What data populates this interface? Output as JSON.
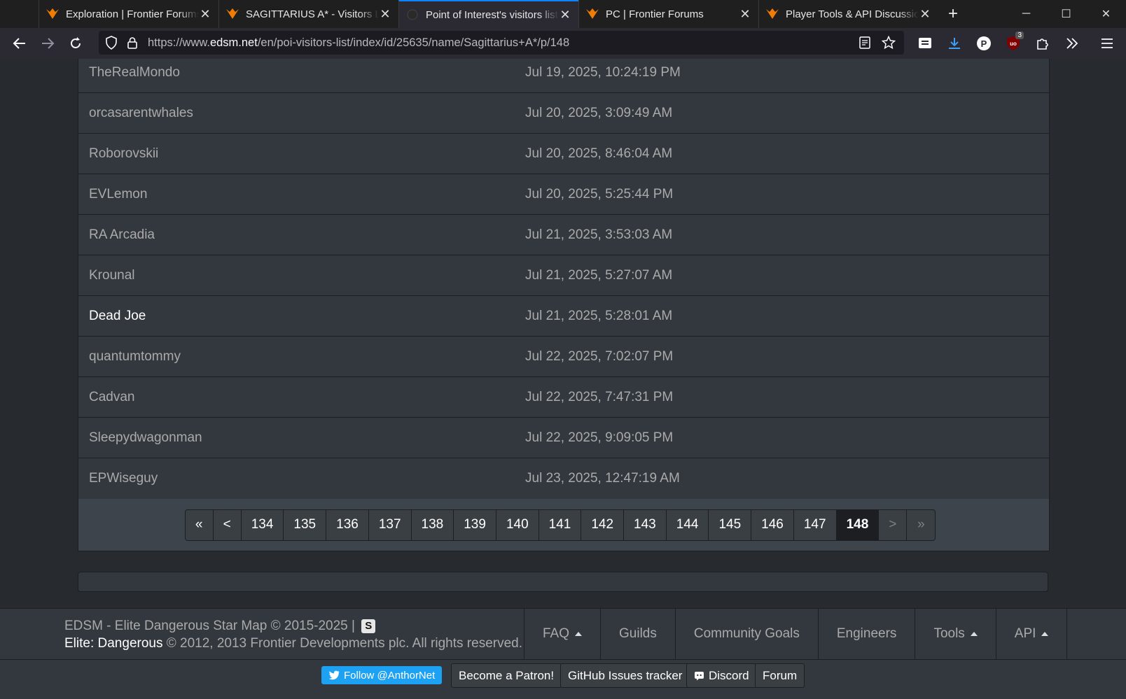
{
  "browser": {
    "tabs": [
      {
        "title": "Exploration | Frontier Forums",
        "active": false,
        "icon": "elite-icon"
      },
      {
        "title": "SAGITTARIUS A* - Visitors List",
        "active": false,
        "icon": "elite-icon"
      },
      {
        "title": "Point of Interest's visitors list",
        "active": true,
        "icon": "edsm-icon"
      },
      {
        "title": "PC | Frontier Forums",
        "active": false,
        "icon": "elite-icon"
      },
      {
        "title": "Player Tools & API Discussions",
        "active": false,
        "icon": "elite-icon"
      }
    ],
    "url_prefix": "https://www.",
    "url_host": "edsm.net",
    "url_path": "/en/poi-visitors-list/index/id/25635/name/Sagittarius+A*/p/148",
    "extension_badge": "3"
  },
  "visitors": [
    {
      "name": "TheRealMondo",
      "date": "Jul 19, 2025, 10:24:19 PM"
    },
    {
      "name": "orcasarentwhales",
      "date": "Jul 20, 2025, 3:09:49 AM"
    },
    {
      "name": "Roborovskii",
      "date": "Jul 20, 2025, 8:46:04 AM"
    },
    {
      "name": "EVLemon",
      "date": "Jul 20, 2025, 5:25:44 PM"
    },
    {
      "name": "RA Arcadia",
      "date": "Jul 21, 2025, 3:53:03 AM"
    },
    {
      "name": "Krounal",
      "date": "Jul 21, 2025, 5:27:07 AM"
    },
    {
      "name": "Dead Joe",
      "date": "Jul 21, 2025, 5:28:01 AM"
    },
    {
      "name": "quantumtommy",
      "date": "Jul 22, 2025, 7:02:07 PM"
    },
    {
      "name": "Cadvan",
      "date": "Jul 22, 2025, 7:47:31 PM"
    },
    {
      "name": "Sleepydwagonman",
      "date": "Jul 22, 2025, 9:09:05 PM"
    },
    {
      "name": "EPWiseguy",
      "date": "Jul 23, 2025, 12:47:19 AM"
    }
  ],
  "pagination": {
    "first": "«",
    "prev": "<",
    "pages": [
      "134",
      "135",
      "136",
      "137",
      "138",
      "139",
      "140",
      "141",
      "142",
      "143",
      "144",
      "145",
      "146",
      "147",
      "148"
    ],
    "current": "148",
    "next": ">",
    "last": "»"
  },
  "footer": {
    "copyright_line1": "EDSM - Elite Dangerous Star Map © 2015-2025 |",
    "s_badge": "S",
    "ed_link": "Elite: Dangerous",
    "copyright_line2": "© 2012, 2013 Frontier Developments plc. All rights reserved.",
    "nav": {
      "faq": "FAQ",
      "guilds": "Guilds",
      "community_goals": "Community Goals",
      "engineers": "Engineers",
      "tools": "Tools",
      "api": "API"
    },
    "twitter": "Follow @AnthorNet",
    "patron": "Become a Patron!",
    "github": "GitHub Issues tracker",
    "discord": "Discord",
    "forum": "Forum"
  }
}
